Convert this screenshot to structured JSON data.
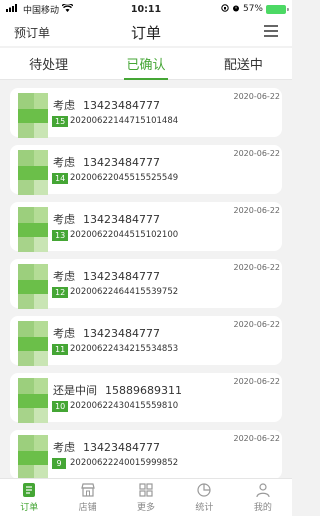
{
  "status_bar": {
    "carrier": "中国移动",
    "time": "10:11",
    "battery": "57%"
  },
  "header": {
    "left_label": "预订单",
    "title": "订单"
  },
  "tabs": [
    {
      "label": "待处理"
    },
    {
      "label": "已确认"
    },
    {
      "label": "配送中"
    }
  ],
  "orders": [
    {
      "name": "考虑",
      "phone": "13423484777",
      "badge": "15",
      "order_no": "20200622144715101484",
      "date": "2020-06-22"
    },
    {
      "name": "考虑",
      "phone": "13423484777",
      "badge": "14",
      "order_no": "20200622045515525549",
      "date": "2020-06-22"
    },
    {
      "name": "考虑",
      "phone": "13423484777",
      "badge": "13",
      "order_no": "20200622044515102100",
      "date": "2020-06-22"
    },
    {
      "name": "考虑",
      "phone": "13423484777",
      "badge": "12",
      "order_no": "20200622464415539752",
      "date": "2020-06-22"
    },
    {
      "name": "考虑",
      "phone": "13423484777",
      "badge": "11",
      "order_no": "20200622434215534853",
      "date": "2020-06-22"
    },
    {
      "name": "还是中间",
      "phone": "15889689311",
      "badge": "10",
      "order_no": "20200622430415559810",
      "date": "2020-06-22"
    },
    {
      "name": "考虑",
      "phone": "13423484777",
      "badge": "9",
      "order_no": "20200622240015999852",
      "date": "2020-06-22"
    }
  ],
  "bottom_nav": [
    {
      "label": "订单",
      "icon": "order-icon"
    },
    {
      "label": "店铺",
      "icon": "store-icon"
    },
    {
      "label": "更多",
      "icon": "more-icon"
    },
    {
      "label": "统计",
      "icon": "stats-icon"
    },
    {
      "label": "我的",
      "icon": "profile-icon"
    }
  ],
  "colors": {
    "accent": "#45a635"
  }
}
